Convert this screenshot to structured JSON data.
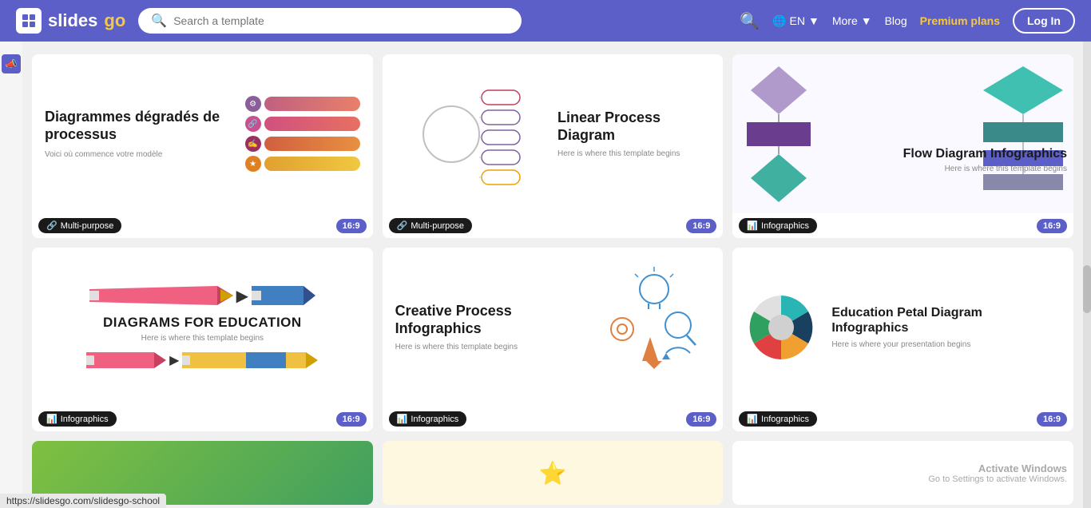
{
  "header": {
    "logo_slides": "slides",
    "logo_go": "go",
    "search_placeholder": "Search a template",
    "lang": "EN",
    "more": "More",
    "blog": "Blog",
    "premium": "Premium plans",
    "login": "Log In"
  },
  "cards": [
    {
      "id": "card1",
      "title": "Diagrammes dégradés de processus",
      "subtitle": "Voici où commence votre modèle",
      "category": "Multi-purpose",
      "ratio": "16:9"
    },
    {
      "id": "card2",
      "title": "Linear Process Diagram",
      "subtitle": "Here is where this template begins",
      "category": "Multi-purpose",
      "ratio": "16:9"
    },
    {
      "id": "card3",
      "title": "Flow Diagram Infographics",
      "subtitle": "Here is where this template begins",
      "category": "Infographics",
      "ratio": "16:9"
    },
    {
      "id": "card4",
      "title": "DIAGRAMS FOR EDUCATION",
      "subtitle": "Here is where this template begins",
      "category": "Infographics",
      "ratio": "16:9"
    },
    {
      "id": "card5",
      "title": "Creative Process Infographics",
      "subtitle": "Here is where this template begins",
      "category": "Infographics",
      "ratio": "16:9"
    },
    {
      "id": "card6",
      "title": "Education Petal Diagram Infographics",
      "subtitle": "Here is where your presentation begins",
      "category": "Infographics",
      "ratio": "16:9"
    }
  ],
  "url": "https://slidesgo.com/slidesgo-school",
  "windows_activation": {
    "line1": "Activate Windows",
    "line2": "Go to Settings to activate Windows."
  }
}
